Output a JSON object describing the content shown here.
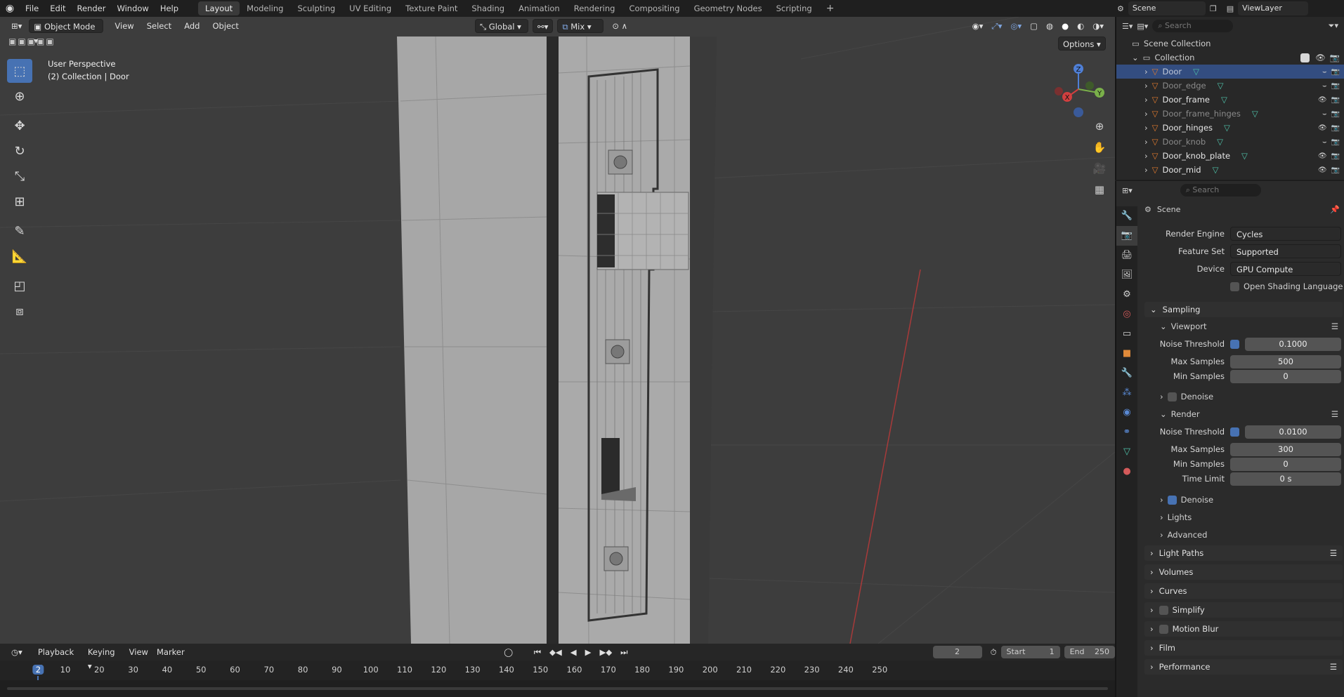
{
  "app": {
    "logo_icon": "blender-logo-icon"
  },
  "menus": [
    "File",
    "Edit",
    "Render",
    "Window",
    "Help"
  ],
  "workspaces": [
    "Layout",
    "Modeling",
    "Sculpting",
    "UV Editing",
    "Texture Paint",
    "Shading",
    "Animation",
    "Rendering",
    "Compositing",
    "Geometry Nodes",
    "Scripting"
  ],
  "active_workspace": "Layout",
  "scene": {
    "name": "Scene",
    "view_layer": "ViewLayer"
  },
  "viewport": {
    "mode": "Object Mode",
    "menus": [
      "View",
      "Select",
      "Add",
      "Object"
    ],
    "orientation": "Global",
    "snap_mode": "Mix",
    "options_label": "Options",
    "info_line1": "User Perspective",
    "info_line2": "(2) Collection | Door",
    "gizmo": {
      "x": "X",
      "y": "Y",
      "z": "Z"
    }
  },
  "outliner": {
    "search_placeholder": "Search",
    "root": "Scene Collection",
    "collection": "Collection",
    "objects": [
      {
        "name": "Door",
        "selected": true,
        "visible": false
      },
      {
        "name": "Door_edge",
        "selected": false,
        "visible": false
      },
      {
        "name": "Door_frame",
        "selected": false,
        "visible": true
      },
      {
        "name": "Door_frame_hinges",
        "selected": false,
        "visible": false
      },
      {
        "name": "Door_hinges",
        "selected": false,
        "visible": true
      },
      {
        "name": "Door_knob",
        "selected": false,
        "visible": false
      },
      {
        "name": "Door_knob_plate",
        "selected": false,
        "visible": true
      },
      {
        "name": "Door_mid",
        "selected": false,
        "visible": true
      }
    ]
  },
  "properties": {
    "search_placeholder": "Search",
    "context": "Scene",
    "render_engine_label": "Render Engine",
    "render_engine": "Cycles",
    "feature_set_label": "Feature Set",
    "feature_set": "Supported",
    "device_label": "Device",
    "device": "GPU Compute",
    "osl_label": "Open Shading Language",
    "sampling": "Sampling",
    "viewport_section": "Viewport",
    "noise_threshold_label": "Noise Threshold",
    "vp_noise_threshold": "0.1000",
    "max_samples_label": "Max Samples",
    "vp_max_samples": "500",
    "min_samples_label": "Min Samples",
    "vp_min_samples": "0",
    "denoise_label": "Denoise",
    "render_section": "Render",
    "r_noise_threshold": "0.0100",
    "r_max_samples": "300",
    "r_min_samples": "0",
    "time_limit_label": "Time Limit",
    "r_time_limit": "0 s",
    "lights": "Lights",
    "advanced": "Advanced",
    "light_paths": "Light Paths",
    "volumes": "Volumes",
    "curves": "Curves",
    "simplify": "Simplify",
    "motion_blur": "Motion Blur",
    "film": "Film",
    "performance": "Performance"
  },
  "timeline": {
    "menus": [
      "Playback",
      "Keying",
      "View",
      "Marker"
    ],
    "current_frame": "2",
    "start_label": "Start",
    "start": "1",
    "end_label": "End",
    "end": "250",
    "ticks": [
      "2",
      "10",
      "20",
      "30",
      "40",
      "50",
      "60",
      "70",
      "80",
      "90",
      "100",
      "110",
      "120",
      "130",
      "140",
      "150",
      "160",
      "170",
      "180",
      "190",
      "200",
      "210",
      "220",
      "230",
      "240",
      "250"
    ]
  },
  "colors": {
    "accent": "#4772b3",
    "selection": "#334d80",
    "object_icon": "#e07a2e",
    "mesh_icon": "#4fc1a9"
  }
}
